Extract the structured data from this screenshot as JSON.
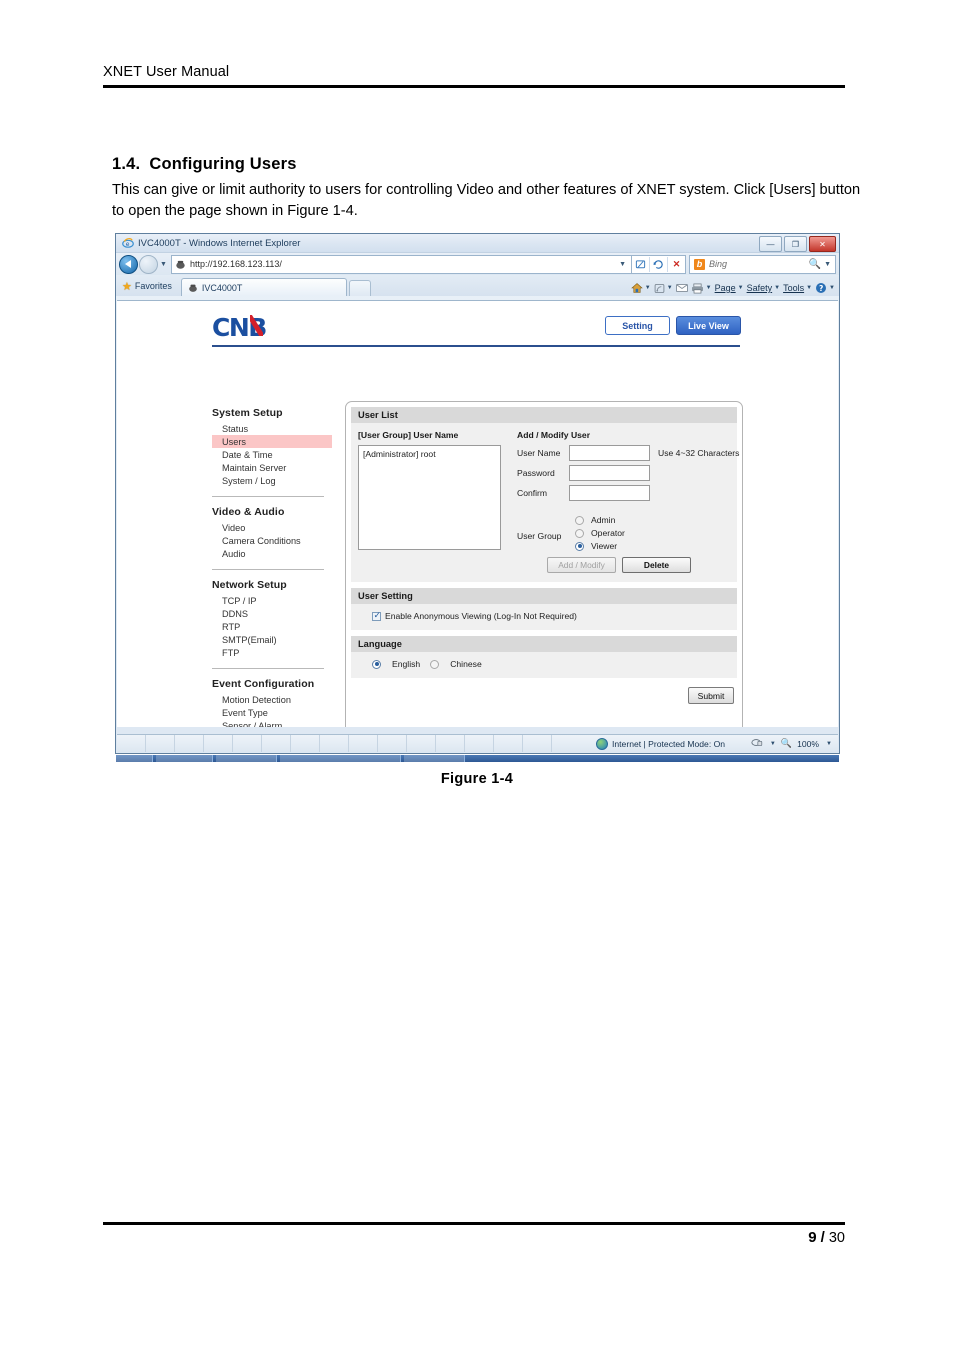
{
  "document": {
    "header": "XNET User Manual",
    "footer_page": "9",
    "footer_sep": "/",
    "footer_total": "30",
    "section_number": "1.4.",
    "section_title": "Configuring Users",
    "body": "This can give or limit authority to users for controlling Video and other features of XNET system. Click [Users] button to open the page shown in Figure 1-4.",
    "figure_caption": "Figure 1-4"
  },
  "browser": {
    "title": "IVC4000T - Windows Internet Explorer",
    "window_buttons": {
      "minimize": "—",
      "restore": "❐",
      "close": "✕"
    },
    "address": {
      "url": "http://192.168.123.113/",
      "dropdown_caret": "▼",
      "compat_icon": "compatibility-view-icon",
      "refresh_icon": "↻",
      "stop_icon": "✕"
    },
    "search": {
      "engine": "Bing",
      "logo_letter": "b",
      "magnifier": "search-icon",
      "caret": "▼"
    },
    "favorites_label": "Favorites",
    "tab": {
      "label": "IVC4000T"
    },
    "command_bar": [
      {
        "name": "home-icon",
        "label": ""
      },
      {
        "name": "feeds-icon",
        "label": ""
      },
      {
        "name": "mail-icon",
        "label": ""
      },
      {
        "name": "print-icon",
        "label": ""
      },
      {
        "name": "page-menu",
        "label": "Page"
      },
      {
        "name": "safety-menu",
        "label": "Safety"
      },
      {
        "name": "tools-menu",
        "label": "Tools"
      },
      {
        "name": "help-icon",
        "label": ""
      }
    ],
    "status": {
      "zone": "Internet | Protected Mode: On",
      "zoom": "100%",
      "zoom_caret": "▼",
      "privacy_caret": "▼"
    }
  },
  "webpage": {
    "logo": "CNB",
    "buttons": {
      "setting": "Setting",
      "live_view": "Live View"
    },
    "sidebar": [
      {
        "group": "System Setup",
        "items": [
          {
            "label": "Status",
            "active": false
          },
          {
            "label": "Users",
            "active": true
          },
          {
            "label": "Date & Time",
            "active": false
          },
          {
            "label": "Maintain Server",
            "active": false
          },
          {
            "label": "System / Log",
            "active": false
          }
        ]
      },
      {
        "group": "Video & Audio",
        "items": [
          {
            "label": "Video",
            "active": false
          },
          {
            "label": "Camera Conditions",
            "active": false
          },
          {
            "label": "Audio",
            "active": false
          }
        ]
      },
      {
        "group": "Network Setup",
        "items": [
          {
            "label": "TCP / IP",
            "active": false
          },
          {
            "label": "DDNS",
            "active": false
          },
          {
            "label": "RTP",
            "active": false
          },
          {
            "label": "SMTP(Email)",
            "active": false
          },
          {
            "label": "FTP",
            "active": false
          }
        ]
      },
      {
        "group": "Event Configuration",
        "items": [
          {
            "label": "Motion Detection",
            "active": false
          },
          {
            "label": "Event Type",
            "active": false
          },
          {
            "label": "Sensor / Alarm",
            "active": false
          }
        ]
      }
    ],
    "user_list": {
      "section_title": "User List",
      "list_header": "[User Group] User Name",
      "list_entries": [
        "[Administrator] root"
      ],
      "form_header": "Add / Modify User",
      "fields": [
        {
          "label": "User Name",
          "value": "",
          "hint": "Use 4~32 Characters"
        },
        {
          "label": "Password",
          "value": "",
          "hint": ""
        },
        {
          "label": "Confirm",
          "value": "",
          "hint": ""
        }
      ],
      "user_group_label": "User Group",
      "user_group_options": [
        {
          "label": "Admin",
          "selected": false
        },
        {
          "label": "Operator",
          "selected": false
        },
        {
          "label": "Viewer",
          "selected": true
        }
      ],
      "add_modify_button": "Add / Modify",
      "delete_button": "Delete"
    },
    "user_setting": {
      "section_title": "User Setting",
      "anonymous_label": "Enable Anonymous Viewing (Log-In Not Required)",
      "anonymous_checked": true
    },
    "language": {
      "section_title": "Language",
      "options": [
        {
          "label": "English",
          "selected": true
        },
        {
          "label": "Chinese",
          "selected": false
        }
      ]
    },
    "submit_button": "Submit"
  },
  "colors": {
    "accent_blue": "#2f62c2",
    "logo_blue": "#1b4fa0",
    "logo_red": "#d3202b",
    "active_item": "#fbc6c6"
  }
}
